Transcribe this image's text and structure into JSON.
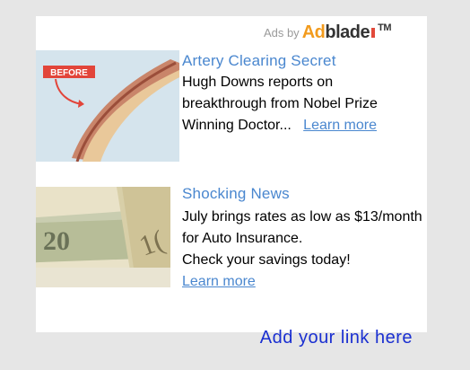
{
  "header": {
    "ads_by": "Ads by",
    "brand_part1": "Ad",
    "brand_part2": "blade",
    "trademark": "TM"
  },
  "ads": [
    {
      "title": "Artery Clearing Secret",
      "body": "Hugh Downs reports on breakthrough from Nobel Prize Winning Doctor...",
      "link_text": "Learn more",
      "thumb_label": "BEFORE"
    },
    {
      "title": "Shocking News",
      "body_line1": "July brings rates as low as $13/month for Auto Insurance.",
      "body_line2": "Check your savings today!",
      "link_text": "Learn more"
    }
  ],
  "footer": {
    "add_link": "Add your link here"
  },
  "colors": {
    "background": "#e6e6e6",
    "title_blue": "#4a87cf",
    "footer_link": "#1a2fd1",
    "brand_orange": "#f29b1d"
  }
}
